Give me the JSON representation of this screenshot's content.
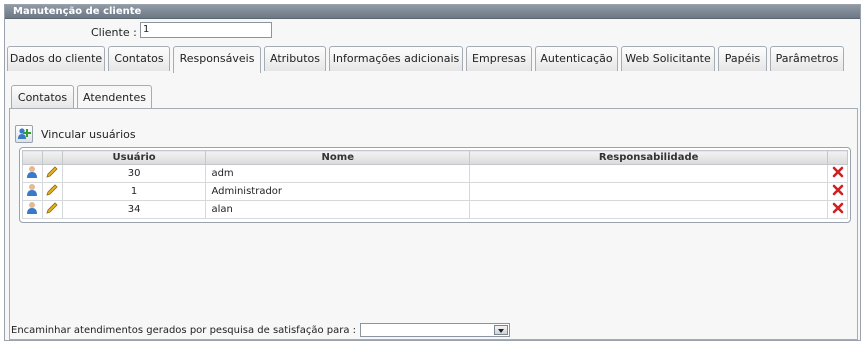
{
  "panel": {
    "title": "Manutenção de cliente"
  },
  "client": {
    "label": "Cliente :",
    "value": "1"
  },
  "tabs": [
    {
      "label": "Dados do cliente",
      "active": false
    },
    {
      "label": "Contatos",
      "active": false
    },
    {
      "label": "Responsáveis",
      "active": true
    },
    {
      "label": "Atributos",
      "active": false
    },
    {
      "label": "Informações adicionais",
      "active": false
    },
    {
      "label": "Empresas",
      "active": false
    },
    {
      "label": "Autenticação",
      "active": false
    },
    {
      "label": "Web Solicitante",
      "active": false
    },
    {
      "label": "Papéis",
      "active": false
    },
    {
      "label": "Parâmetros",
      "active": false
    }
  ],
  "subtabs": [
    {
      "label": "Contatos",
      "active": false
    },
    {
      "label": "Atendentes",
      "active": true
    }
  ],
  "toolbar": {
    "vincular_label": "Vincular usuários"
  },
  "grid": {
    "columns": [
      "Usuário",
      "Nome",
      "Responsabilidade"
    ],
    "rows": [
      {
        "usuario": "30",
        "nome": "adm",
        "responsabilidade": ""
      },
      {
        "usuario": "1",
        "nome": "Administrador",
        "responsabilidade": ""
      },
      {
        "usuario": "34",
        "nome": "alan",
        "responsabilidade": ""
      }
    ]
  },
  "footer": {
    "label": "Encaminhar atendimentos gerados por pesquisa de satisfação para :",
    "select_value": ""
  },
  "colors": {
    "title_bar": "#7a8692",
    "delete": "#d22020",
    "edit": "#e8b020",
    "user": "#3a78c8"
  }
}
